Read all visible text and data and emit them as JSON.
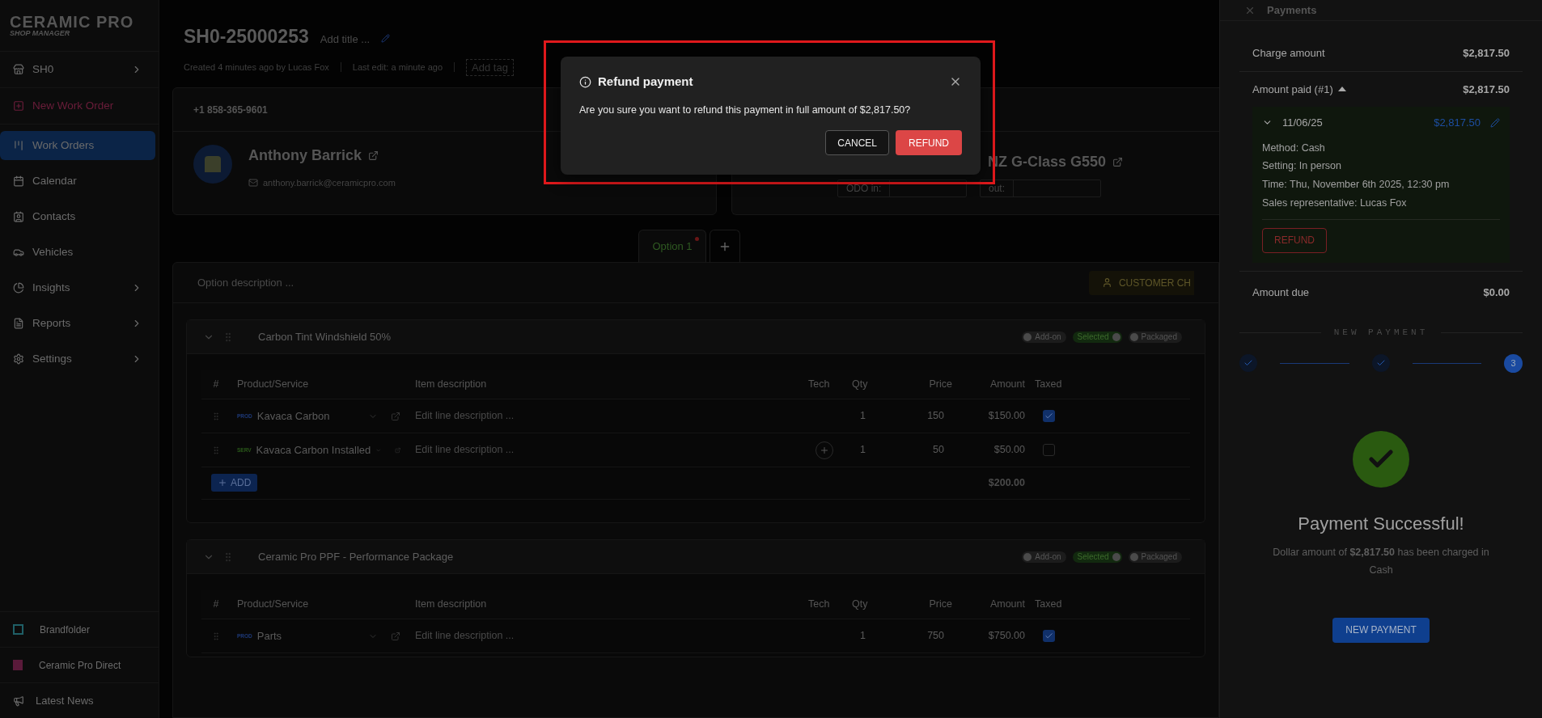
{
  "logo": {
    "title": "CERAMIC PRO",
    "subtitle": "SHOP MANAGER"
  },
  "sidebar": {
    "items": [
      {
        "label": "SH0",
        "chevron": true,
        "kind": "normal",
        "selected": false
      },
      {
        "label": "New Work Order",
        "chevron": false,
        "kind": "action",
        "selected": false
      },
      {
        "label": "Work Orders",
        "chevron": false,
        "kind": "normal",
        "selected": true
      },
      {
        "label": "Calendar",
        "chevron": false,
        "kind": "normal",
        "selected": false
      },
      {
        "label": "Contacts",
        "chevron": false,
        "kind": "normal",
        "selected": false
      },
      {
        "label": "Vehicles",
        "chevron": false,
        "kind": "normal",
        "selected": false
      },
      {
        "label": "Insights",
        "chevron": true,
        "kind": "normal",
        "selected": false
      },
      {
        "label": "Reports",
        "chevron": true,
        "kind": "normal",
        "selected": false
      },
      {
        "label": "Settings",
        "chevron": true,
        "kind": "normal",
        "selected": false
      }
    ],
    "links": [
      "Brandfolder",
      "Ceramic Pro Direct",
      "Latest News"
    ]
  },
  "work_order": {
    "number": "SH0-25000253",
    "title_placeholder": "Add title ...",
    "created": "Created 4 minutes ago by Lucas Fox",
    "last_edit": "Last edit: a minute ago",
    "tag_placeholder": "Add tag"
  },
  "customer": {
    "phone": "+1 858-365-9601",
    "name": "Anthony Barrick",
    "email": "anthony.barrick@ceramicpro.com"
  },
  "vehicle": {
    "name": "NZ G-Class G550",
    "odo_in_label": "ODO in:",
    "odo_out_label": "out:"
  },
  "option_tabs": [
    {
      "label": "Option 1",
      "selected": true,
      "unsaved": true
    }
  ],
  "option": {
    "description_placeholder": "Option description ...",
    "customer_button": "CUSTOMER CH",
    "groups": [
      {
        "name": "Carbon Tint Windshield 50%",
        "toggles": [
          {
            "label": "Add-on",
            "on": false
          },
          {
            "label": "Selected",
            "on": true
          },
          {
            "label": "Packaged",
            "on": false
          }
        ],
        "columns": [
          "#",
          "Product/Service",
          "Item description",
          "Tech",
          "Qty",
          "Price",
          "Amount",
          "Taxed"
        ],
        "rows": [
          {
            "type": "PROD",
            "name": "Kavaca Carbon",
            "description_placeholder": "Edit line description ...",
            "tech_add": false,
            "qty": "1",
            "price": "150",
            "amount": "$150.00",
            "taxed": true
          },
          {
            "type": "SERV",
            "name": "Kavaca Carbon Installed",
            "description_placeholder": "Edit line description ...",
            "tech_add": true,
            "qty": "1",
            "price": "50",
            "amount": "$50.00",
            "taxed": false
          }
        ],
        "add_label": "ADD",
        "total": "$200.00"
      },
      {
        "name": "Ceramic Pro PPF - Performance Package",
        "toggles": [
          {
            "label": "Add-on",
            "on": false
          },
          {
            "label": "Selected",
            "on": true
          },
          {
            "label": "Packaged",
            "on": false
          }
        ],
        "columns": [
          "#",
          "Product/Service",
          "Item description",
          "Tech",
          "Qty",
          "Price",
          "Amount",
          "Taxed"
        ],
        "rows": [
          {
            "type": "PROD",
            "name": "Parts",
            "description_placeholder": "Edit line description ...",
            "tech_add": false,
            "qty": "1",
            "price": "750",
            "amount": "$750.00",
            "taxed": true
          }
        ]
      }
    ]
  },
  "payments": {
    "title": "Payments",
    "charge_label": "Charge amount",
    "charge_value": "$2,817.50",
    "paid_label": "Amount paid (#1)",
    "paid_value": "$2,817.50",
    "expanded": true,
    "payment": {
      "date": "11/06/25",
      "amount": "$2,817.50",
      "details": [
        "Method: Cash",
        "Setting: In person",
        "Time: Thu, November 6th 2025, 12:30 pm",
        "Sales representative: Lucas Fox"
      ],
      "refund_label": "REFUND"
    },
    "due_label": "Amount due",
    "due_value": "$0.00",
    "new_payment_heading": "NEW PAYMENT",
    "steps": [
      {
        "kind": "done"
      },
      {
        "kind": "done"
      },
      {
        "kind": "current",
        "label": "3"
      }
    ],
    "success_title": "Payment Successful!",
    "success_text": "Dollar amount of **$2,817.50** has been charged in Cash",
    "new_payment_button": "NEW PAYMENT"
  },
  "dialog": {
    "title": "Refund payment",
    "message": "Are you sure you want to refund this payment in full amount of $2,817.50?",
    "cancel": "CANCEL",
    "confirm": "REFUND"
  }
}
